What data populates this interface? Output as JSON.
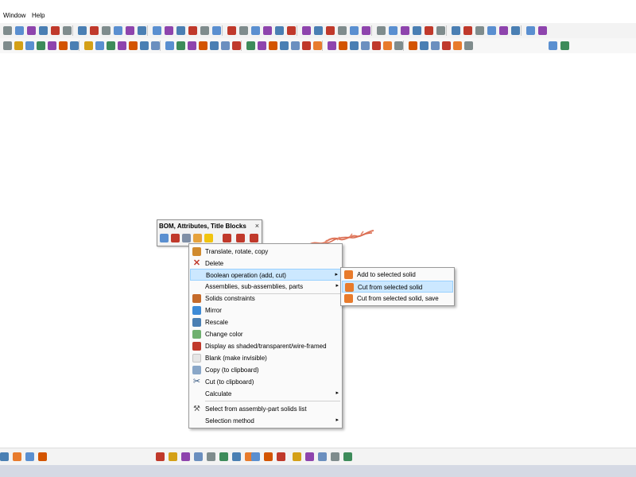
{
  "menubar": {
    "items": [
      "Window",
      "Help"
    ]
  },
  "float_toolbar": {
    "title": "BOM, Attributes, Title Blocks",
    "close_glyph": "×"
  },
  "context_menu": {
    "items": [
      {
        "label": "Translate, rotate, copy",
        "icon": "translate-icon",
        "submenu": false
      },
      {
        "label": "Delete",
        "icon": "delete-icon",
        "submenu": false
      },
      {
        "label": "Boolean operation (add, cut)",
        "icon": "",
        "submenu": true,
        "highlighted": true
      },
      {
        "label": "Assemblies, sub-assemblies, parts",
        "icon": "",
        "submenu": true
      },
      {
        "label": "Solids constraints",
        "icon": "constraints-icon",
        "submenu": false
      },
      {
        "label": "Mirror",
        "icon": "mirror-icon",
        "submenu": false
      },
      {
        "label": "Rescale",
        "icon": "rescale-icon",
        "submenu": false
      },
      {
        "label": "Change color",
        "icon": "color-icon",
        "submenu": false
      },
      {
        "label": "Display as shaded/transparent/wire-framed",
        "icon": "display-mode-icon",
        "submenu": false
      },
      {
        "label": "Blank (make invisible)",
        "icon": "blank-icon",
        "submenu": false
      },
      {
        "label": "Copy (to clipboard)",
        "icon": "copy-icon",
        "submenu": false
      },
      {
        "label": "Cut (to clipboard)",
        "icon": "scissors-icon",
        "submenu": false
      },
      {
        "label": "Calculate",
        "icon": "",
        "submenu": true
      },
      {
        "label": "Select from assembly-part solids list",
        "icon": "select-list-icon",
        "submenu": false
      },
      {
        "label": "Selection method",
        "icon": "",
        "submenu": true
      }
    ],
    "submenu_arrow": "▸"
  },
  "submenu": {
    "items": [
      {
        "label": "Add to selected solid",
        "icon": "boolean-add-icon"
      },
      {
        "label": "Cut from selected solid",
        "icon": "boolean-cut-icon",
        "highlighted": true
      },
      {
        "label": "Cut from selected solid, save",
        "icon": "boolean-cut-save-icon"
      }
    ]
  },
  "colors": {
    "highlight": "#cce8ff",
    "highlight_border": "#99d1ff",
    "toolbar_bg": "#f3f3f3",
    "statusbar_bg": "#d5d9e4",
    "scribble": "#e07a5f"
  }
}
